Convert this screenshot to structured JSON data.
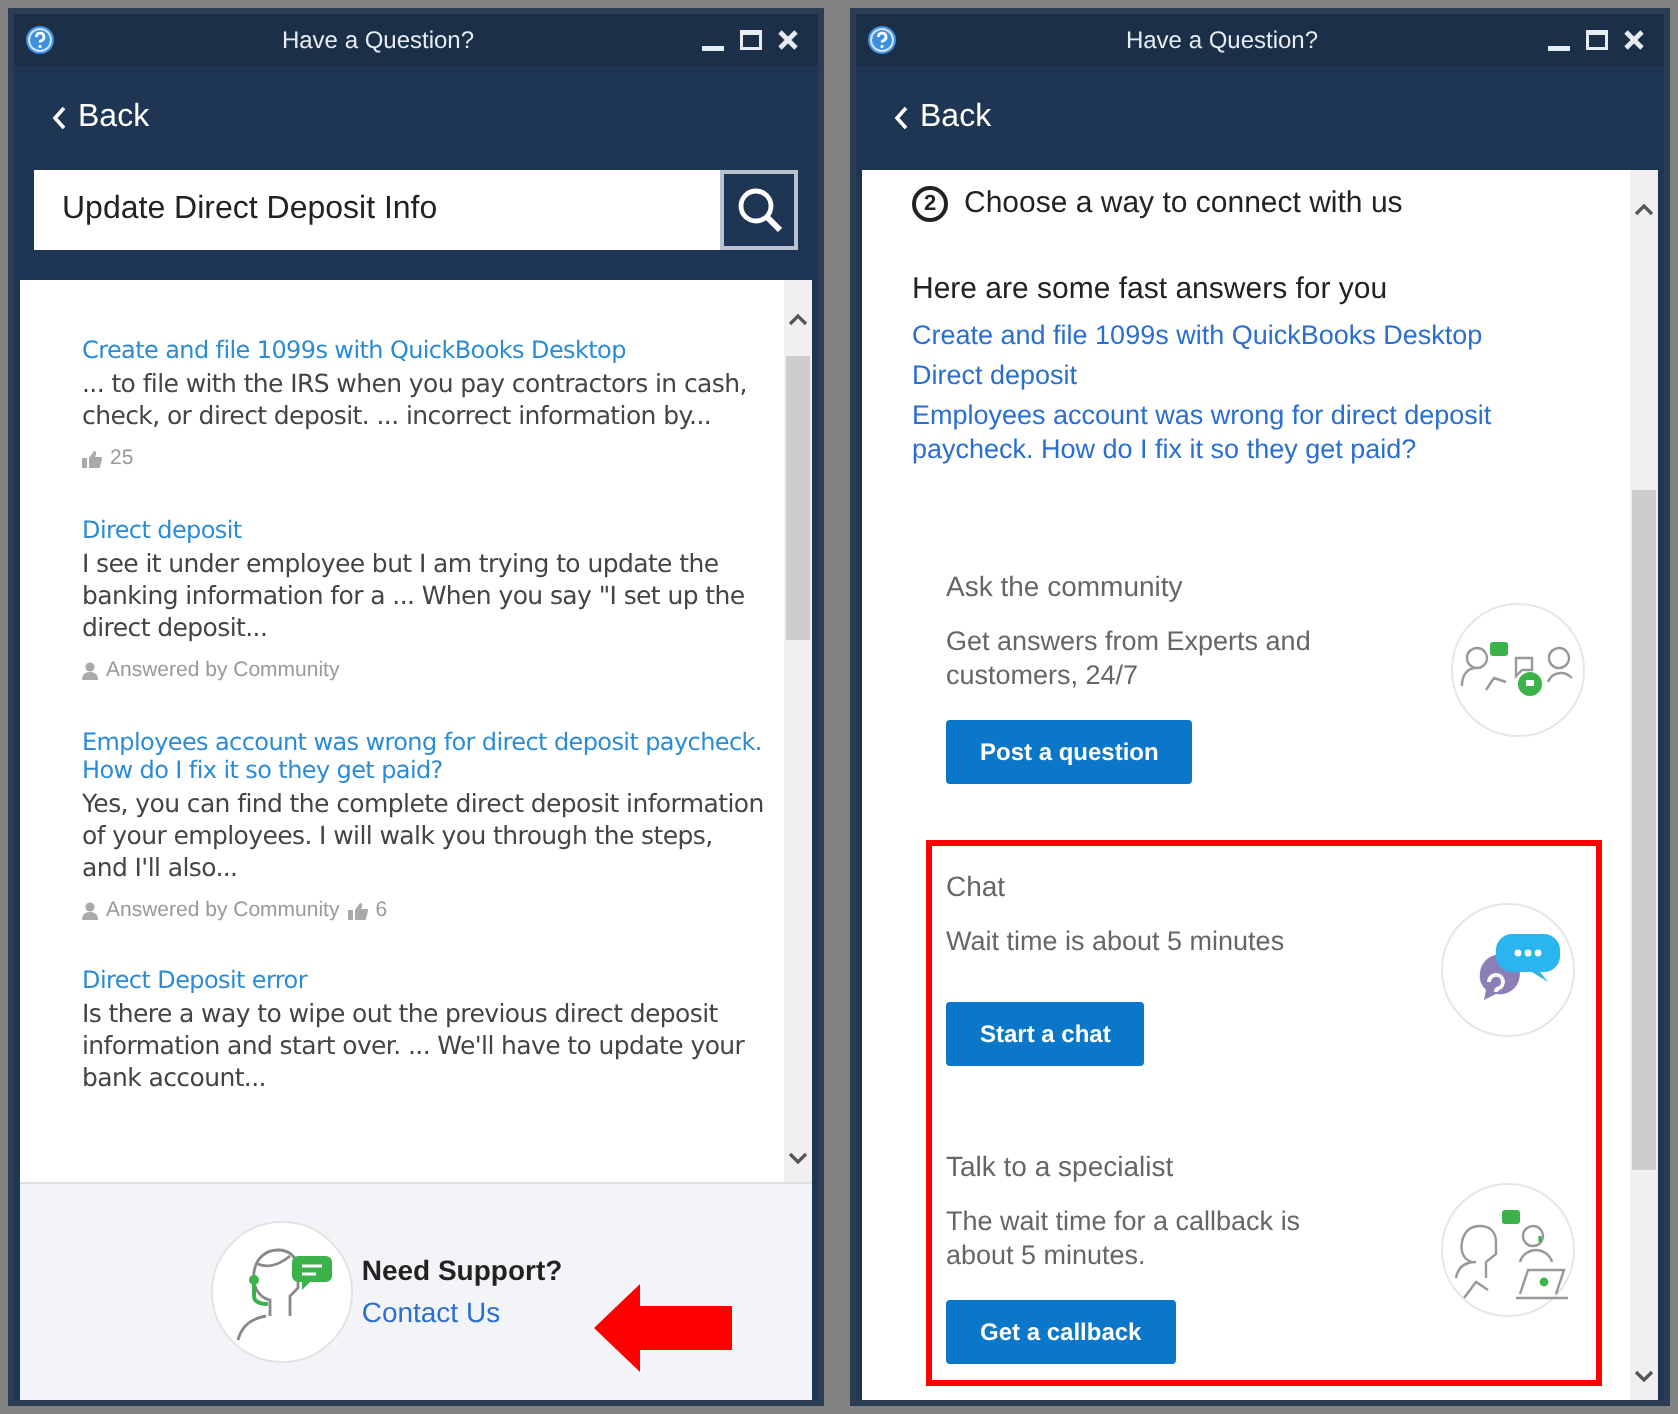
{
  "left_window": {
    "title": "Have a Question?",
    "back": "Back",
    "search": {
      "value": "Update Direct Deposit Info"
    },
    "results": [
      {
        "title": "Create and file 1099s with QuickBooks Desktop",
        "snippet": "... to file with the IRS when you pay contractors in cash, check, or direct deposit. ... incorrect information by...",
        "likes": "25"
      },
      {
        "title": "Direct deposit",
        "snippet": "I see it under employee but I am trying to update the banking information for a ... When you say \"I set up the direct deposit...",
        "answered": "Answered by Community"
      },
      {
        "title": "Employees account was wrong for direct deposit paycheck. How do I fix it so they get paid?",
        "snippet": "Yes, you can find the complete direct deposit information of your employees. I will walk you through the steps, and I'll also...",
        "answered": "Answered by Community",
        "likes": "6"
      },
      {
        "title": "Direct Deposit error",
        "snippet": "Is there a way to wipe out the previous direct deposit information and start over. ... We'll have to update your bank account..."
      }
    ],
    "support": {
      "heading": "Need Support?",
      "link": "Contact Us",
      "arrow": true
    }
  },
  "right_window": {
    "title": "Have a Question?",
    "back": "Back",
    "step": {
      "number": "2",
      "text": "Choose a way to connect with us"
    },
    "fast_answers": {
      "heading": "Here are some fast answers for you",
      "links": [
        "Create and file 1099s with QuickBooks Desktop",
        "Direct deposit",
        "Employees account was wrong for direct deposit paycheck. How do I fix it so they get paid?"
      ]
    },
    "options": [
      {
        "kind": "community",
        "title": "Ask the community",
        "description": "Get answers from Experts and customers, 24/7",
        "button": "Post a question",
        "highlighted": false
      },
      {
        "kind": "chat",
        "title": "Chat",
        "description": "Wait time is about 5 minutes",
        "button": "Start a chat",
        "highlighted": true
      },
      {
        "kind": "callback",
        "title": "Talk to a specialist",
        "description": "The wait time for a callback is about 5 minutes.",
        "button": "Get a callback",
        "highlighted": true
      }
    ]
  }
}
